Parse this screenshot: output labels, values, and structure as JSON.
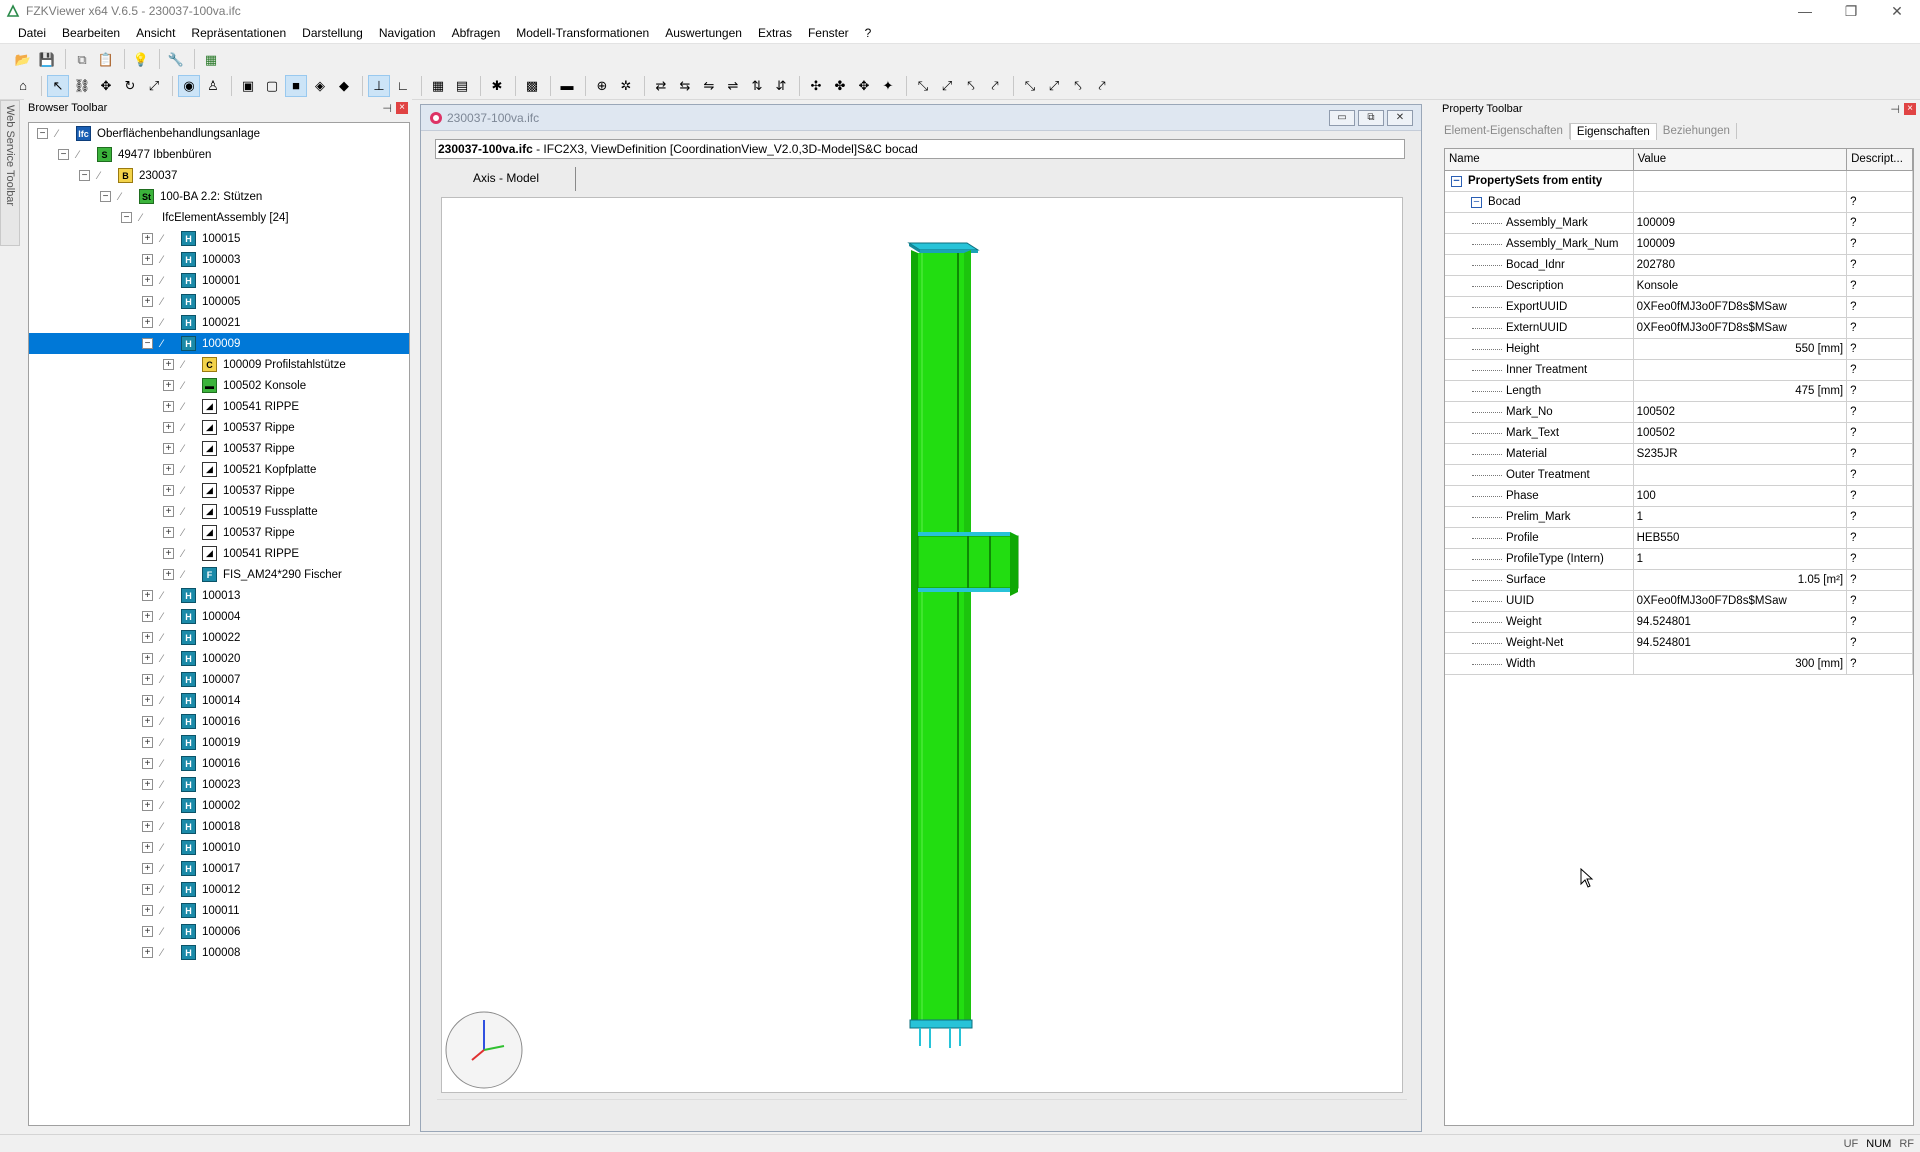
{
  "app": {
    "title": "FZKViewer x64 V.6.5 - 230037-100va.ifc",
    "win_min": "—",
    "win_max": "❐",
    "win_close": "✕"
  },
  "menu": [
    "Datei",
    "Bearbeiten",
    "Ansicht",
    "Repräsentationen",
    "Darstellung",
    "Navigation",
    "Abfragen",
    "Modell-Transformationen",
    "Auswertungen",
    "Extras",
    "Fenster",
    "?"
  ],
  "web_service_toolbar": "Web Service Toolbar",
  "browser": {
    "header": "Browser Toolbar",
    "pin": "⊣",
    "close": "×",
    "root": "Oberflächenbehandlungsanlage",
    "site": "49477 Ibbenbüren",
    "building": "230037",
    "storey": "100-BA 2.2: Stützen",
    "assembly_group": "IfcElementAssembly [24]",
    "assemblies_before": [
      "100015",
      "100003",
      "100001",
      "100005",
      "100021"
    ],
    "selected": "100009",
    "children": [
      {
        "label": "100009 Profilstahlstütze",
        "icon": "column-icon"
      },
      {
        "label": "100502 Konsole",
        "icon": "member-icon"
      },
      {
        "label": "100541 RIPPE",
        "icon": "plate-icon"
      },
      {
        "label": "100537 Rippe",
        "icon": "plate-icon"
      },
      {
        "label": "100537 Rippe",
        "icon": "plate-icon"
      },
      {
        "label": "100521 Kopfplatte",
        "icon": "plate-icon"
      },
      {
        "label": "100537 Rippe",
        "icon": "plate-icon"
      },
      {
        "label": "100519 Fussplatte",
        "icon": "plate-icon"
      },
      {
        "label": "100537 Rippe",
        "icon": "plate-icon"
      },
      {
        "label": "100541 RIPPE",
        "icon": "plate-icon"
      },
      {
        "label": "FIS_AM24*290 Fischer",
        "icon": "fastener-icon"
      }
    ],
    "assemblies_after": [
      "100013",
      "100004",
      "100022",
      "100020",
      "100007",
      "100014",
      "100016",
      "100019",
      "100016",
      "100023",
      "100002",
      "100018",
      "100010",
      "100017",
      "100012",
      "100011",
      "100006",
      "100008"
    ]
  },
  "document": {
    "title": "230037-100va.ifc",
    "file_bold": "230037-100va.ifc",
    "file_info": " - IFC2X3, ViewDefinition [CoordinationView_V2.0,3D-Model]S&C bocad",
    "tab": "Axis - Model",
    "btn_min": "▭",
    "btn_max": "⧉",
    "btn_close": "✕"
  },
  "property": {
    "header": "Property Toolbar",
    "pin": "⊣",
    "close": "×",
    "tabs": [
      "Element-Eigenschaften",
      "Eigenschaften",
      "Beziehungen"
    ],
    "active_tab": "Eigenschaften",
    "columns": [
      "Name",
      "Value",
      "Descript..."
    ],
    "group": "PropertySets from entity",
    "subgroup": "Bocad",
    "subgroup_desc": "?",
    "rows": [
      {
        "name": "Assembly_Mark",
        "value": "100009",
        "desc": "?",
        "align": "left"
      },
      {
        "name": "Assembly_Mark_Num",
        "value": "100009",
        "desc": "?",
        "align": "left"
      },
      {
        "name": "Bocad_Idnr",
        "value": "202780",
        "desc": "?",
        "align": "left"
      },
      {
        "name": "Description",
        "value": "Konsole",
        "desc": "?",
        "align": "left"
      },
      {
        "name": "ExportUUID",
        "value": "0XFeo0fMJ3o0F7D8s$MSaw",
        "desc": "?",
        "align": "left"
      },
      {
        "name": "ExternUUID",
        "value": "0XFeo0fMJ3o0F7D8s$MSaw",
        "desc": "?",
        "align": "left"
      },
      {
        "name": "Height",
        "value": "550 [mm]",
        "desc": "?",
        "align": "right"
      },
      {
        "name": "Inner Treatment",
        "value": "",
        "desc": "?",
        "align": "left"
      },
      {
        "name": "Length",
        "value": "475 [mm]",
        "desc": "?",
        "align": "right"
      },
      {
        "name": "Mark_No",
        "value": "100502",
        "desc": "?",
        "align": "left"
      },
      {
        "name": "Mark_Text",
        "value": "100502",
        "desc": "?",
        "align": "left"
      },
      {
        "name": "Material",
        "value": "S235JR",
        "desc": "?",
        "align": "left"
      },
      {
        "name": "Outer Treatment",
        "value": "",
        "desc": "?",
        "align": "left"
      },
      {
        "name": "Phase",
        "value": "100",
        "desc": "?",
        "align": "left"
      },
      {
        "name": "Prelim_Mark",
        "value": "1",
        "desc": "?",
        "align": "left"
      },
      {
        "name": "Profile",
        "value": "HEB550",
        "desc": "?",
        "align": "left"
      },
      {
        "name": "ProfileType (Intern)",
        "value": "1",
        "desc": "?",
        "align": "left"
      },
      {
        "name": "Surface",
        "value": "1.05 [m²]",
        "desc": "?",
        "align": "right"
      },
      {
        "name": "UUID",
        "value": "0XFeo0fMJ3o0F7D8s$MSaw",
        "desc": "?",
        "align": "left"
      },
      {
        "name": "Weight",
        "value": "94.524801",
        "desc": "?",
        "align": "left"
      },
      {
        "name": "Weight-Net",
        "value": "94.524801",
        "desc": "?",
        "align": "left"
      },
      {
        "name": "Width",
        "value": "300 [mm]",
        "desc": "?",
        "align": "right"
      }
    ]
  },
  "status": [
    "UF",
    "NUM",
    "RF"
  ],
  "colors": {
    "selection": "#0078d7",
    "model_green": "#22dd11",
    "model_cyan": "#27c3d8"
  }
}
